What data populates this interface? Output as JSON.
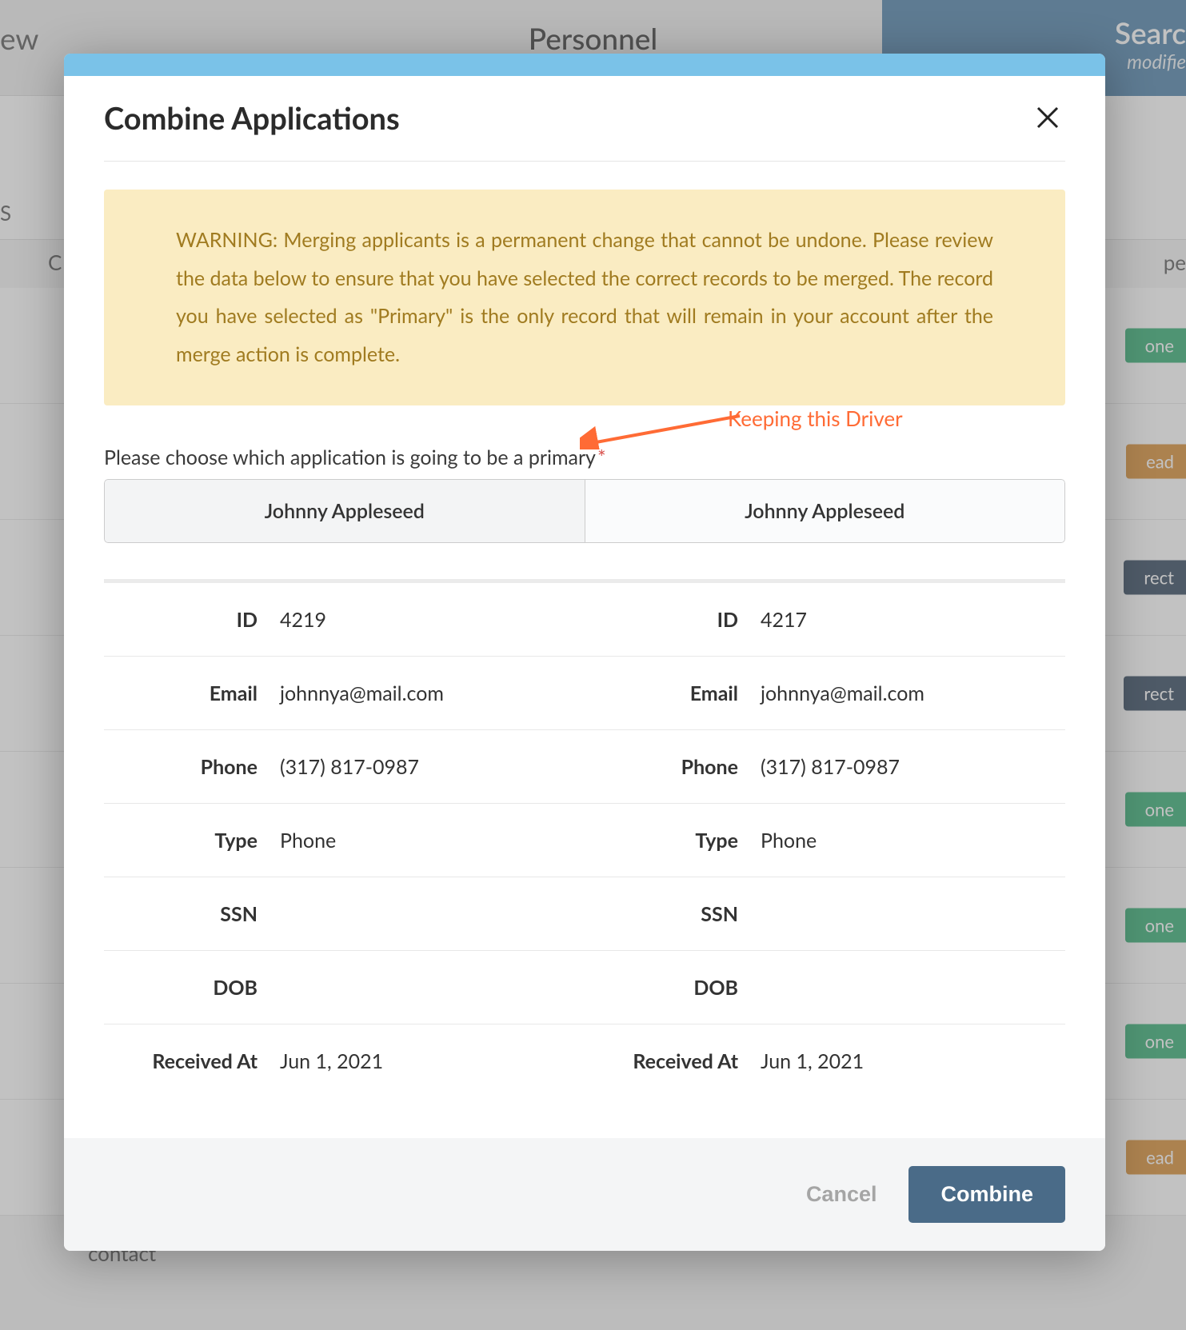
{
  "bg": {
    "tab_left": "ew",
    "tab_center": "Personnel",
    "tab_right_top": "Searc",
    "tab_right_bottom": "modifie",
    "subheader_left": "S",
    "subheader_c": "C",
    "subheader_pe": "pe",
    "badges": [
      "one",
      "ead",
      "rect",
      "rect",
      "one",
      "one",
      "one",
      "ead"
    ],
    "contact": "contact"
  },
  "modal": {
    "title": "Combine Applications",
    "warning": "WARNING: Merging applicants is a permanent change that cannot be undone. Please review the data below to ensure that you have selected the correct records to be merged. The record you have selected as \"Primary\" is the only record that will remain in your account after the merge action is complete.",
    "choose_label": "Please choose which application is going to be a primary",
    "annotation": "Keeping this Driver",
    "option_left": "Johnny Appleseed",
    "option_right": "Johnny Appleseed",
    "fields": {
      "id": "ID",
      "email": "Email",
      "phone": "Phone",
      "type": "Type",
      "ssn": "SSN",
      "dob": "DOB",
      "received": "Received At"
    },
    "left": {
      "id": "4219",
      "email": "johnnya@mail.com",
      "phone": "(317) 817-0987",
      "type": "Phone",
      "ssn": "",
      "dob": "",
      "received": "Jun 1, 2021"
    },
    "right": {
      "id": "4217",
      "email": "johnnya@mail.com",
      "phone": "(317) 817-0987",
      "type": "Phone",
      "ssn": "",
      "dob": "",
      "received": "Jun 1, 2021"
    },
    "footer": {
      "cancel": "Cancel",
      "combine": "Combine"
    }
  }
}
